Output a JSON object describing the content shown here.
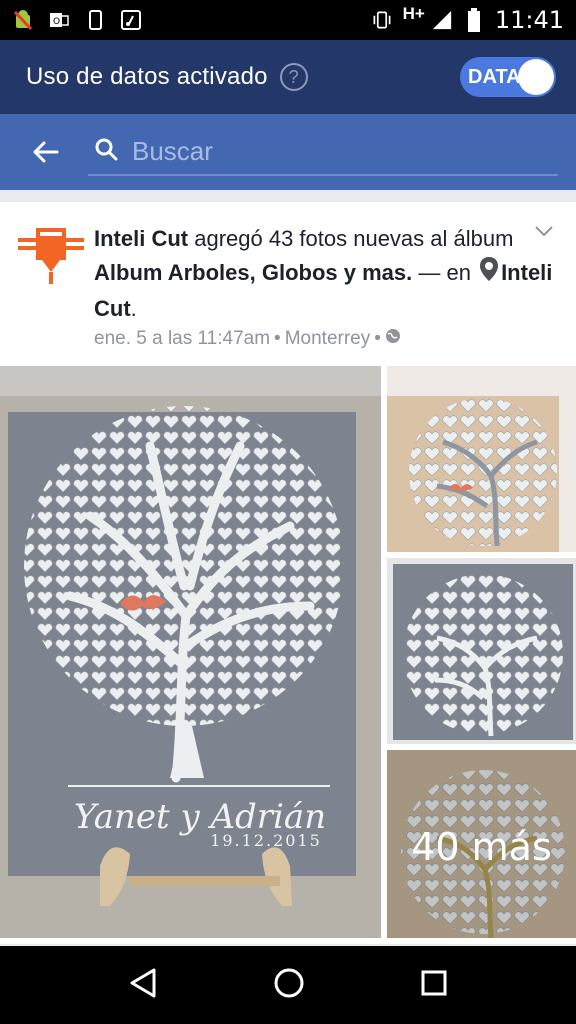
{
  "status_bar": {
    "network": "H+",
    "time": "11:41",
    "icons": [
      "android-debug-icon",
      "outlook-icon",
      "phone-icon",
      "sound-icon",
      "vibrate-icon",
      "signal-icon",
      "battery-icon"
    ]
  },
  "data_banner": {
    "title": "Uso de datos activado",
    "help_label": "?",
    "toggle_label": "DATA",
    "toggle_on": true
  },
  "search": {
    "placeholder": "Buscar"
  },
  "post": {
    "author": "Inteli Cut",
    "action_text": " agregó 43 fotos nuevas al álbum ",
    "album": "Album Arboles, Globos y mas.",
    "location_prefix": " — en ",
    "location_page": "Inteli Cut",
    "location_suffix": ".",
    "timestamp": "ene. 5 a las 11:47am",
    "separator": "•",
    "place": "Monterrey",
    "privacy": "public-globe-icon"
  },
  "photos": {
    "main_caption_names": "Yanet y Adrián",
    "main_caption_date": "19.12.2015",
    "more_label": "40 más"
  },
  "colors": {
    "status_bg": "#000000",
    "banner_bg": "#233769",
    "search_bg": "#4367b0",
    "toggle": "#4b79e0",
    "brand_orange": "#f26522"
  }
}
